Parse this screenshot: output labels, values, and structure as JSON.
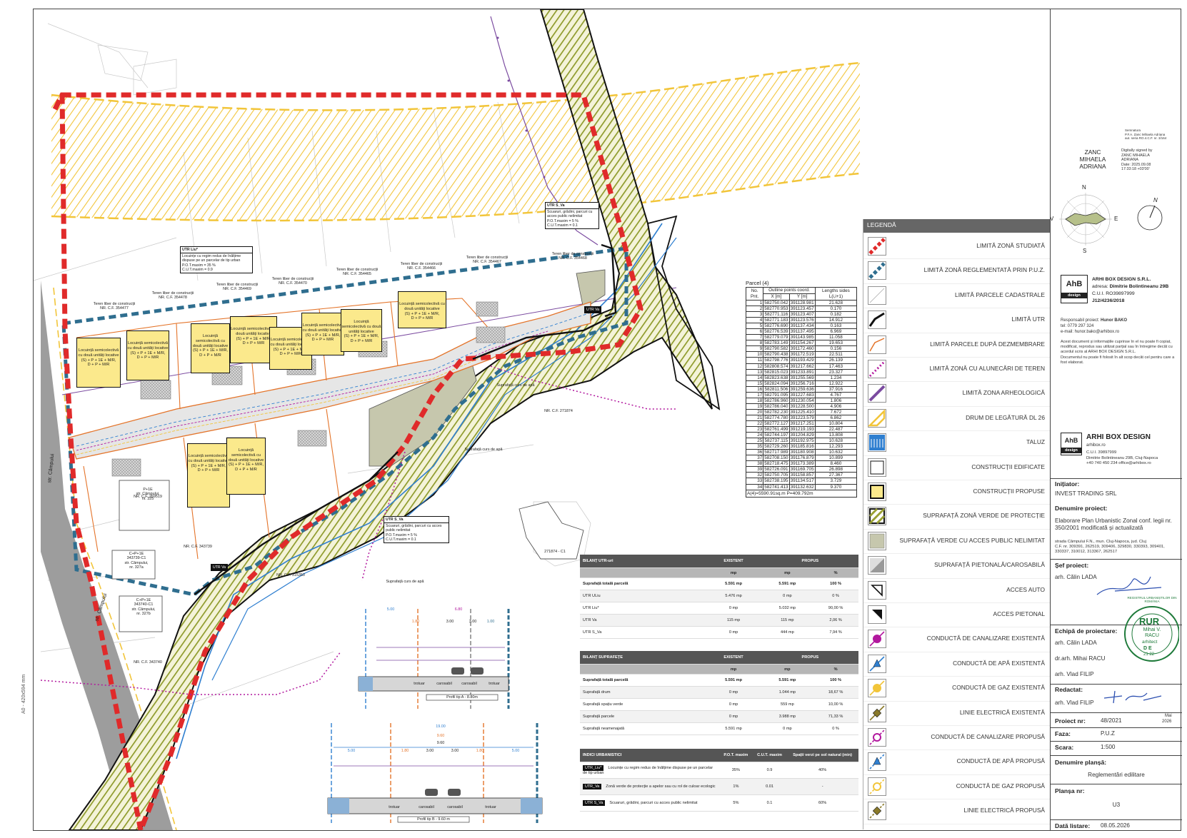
{
  "sideways_note": "A0 - 420x594 mm",
  "map": {
    "street_label_1": "str. Câmpului",
    "street_label_2": "str. Câmpului",
    "labels": [
      {
        "text": "Teren liber de construcții\nNR. C.F. 354477"
      },
      {
        "text": "Teren liber de construcții\nNR. C.F. 354478"
      },
      {
        "text": "Teren liber de construcții\nNR. C.F. 354469"
      },
      {
        "text": "Teren liber de construcții\nNR. C.F. 354470"
      },
      {
        "text": "Teren liber de construcții\nNR. C.F. 354465"
      },
      {
        "text": "Teren liber de construcții\nNR. C.F. 354466"
      },
      {
        "text": "Teren liber de construcții\nNR. C.F. 354467"
      },
      {
        "text": "Teren liber de construcții\nNR. C.F. 354468"
      },
      {
        "text": "NR. C.F. 271874"
      },
      {
        "text": "NR. C.F. 269519"
      },
      {
        "text": "NR. C.F. 343739"
      },
      {
        "text": "NR. C.F. 315350"
      },
      {
        "text": "NR. C.F. 343740"
      },
      {
        "text": "P+1E\nstr. Câmpului,\nnr. 325"
      },
      {
        "text": "C+P+1E\n343739-C1\nstr. Câmpului,\nnr. 327a"
      },
      {
        "text": "C+P+1E\n343740-C1\nstr. Câmpului,\nnr. 327b"
      },
      {
        "text": "271874 - C1"
      },
      {
        "text": "Suprafață curs de apă"
      },
      {
        "text": "Suprafață curs de apă"
      },
      {
        "text": "Suprafață curs de apă"
      }
    ],
    "buildings": [
      "Locuință semicolectivă cu două unități locative\n(S) + P + 1E + M/R,\nD + P + M/R",
      "Locuință semicolectivă cu două unități locative\n(S) + P + 1E + M/R,\nD + P + M/R",
      "Locuință semicolectivă cu două unități locative\n(S) + P + 1E + M/R,\nD + P + M/R",
      "Locuință semicolectivă cu două unități locative\n(S) + P + 1E + M/R,\nD + P + M/R",
      "Locuință semicolectivă cu două unități locative\n(S) + P + 1E + M/R,\nD + P + M/R",
      "Locuință semicolectivă cu două unități locative\n(S) + P + 1E + M/R,\nD + P + M/R",
      "Locuință semicolectivă cu două unități locative\n(S) + P + 1E + M/R,\nD + P + M/R",
      "Locuință semicolectivă cu două unități locative\n(S) + P + 1E + M/R,\nD + P + M/R",
      "Locuință semicolectivă cu două unități locative\n(S) + P + 1E + M/R,\nD + P + M/R",
      "Locuință semicolectivă cu două unități locative\n(S) + P + 1E + M/R,\nD + P + M/R"
    ],
    "utr_boxes": [
      {
        "title": "UTR Liu*",
        "text": "Locuințe cu regim redus de înălțime dispuse pe un parcelar de tip urban\nP.O.T.maxim = 35 %\nC.U.T.maxim = 0.9"
      },
      {
        "title": "UTR S_Va",
        "text": "Scuaruri, grădini, parcuri cu acces public nelimitat\nP.O.T.maxim = 5 %\nC.U.T.maxim = 0.1"
      },
      {
        "title": "UTR S_Va",
        "text": "Scuaruri, grădini, parcuri cu acces public nelimitat\nP.O.T.maxim = 5 %\nC.U.T.maxim = 0.1"
      }
    ],
    "profile_a": {
      "title": "Profil tip A - 8.80m",
      "dims": [
        "5.00",
        "6.80",
        "1.80",
        "3.00",
        "3.00",
        "1.00"
      ],
      "labels": [
        "trotuar",
        "carosabil",
        "carosabil",
        "trotuar"
      ]
    },
    "profile_b": {
      "title": "Profil tip B - 9.60 m",
      "dims": [
        "19.00",
        "9.60",
        "9.60",
        "5.00",
        "1.80",
        "3.00",
        "3.00",
        "1.80",
        "5.00"
      ],
      "labels": [
        "trotuar",
        "carosabil",
        "carosabil",
        "trotuar"
      ]
    },
    "utr_tags": [
      "UTR Va",
      "UTR Va"
    ]
  },
  "parcel": {
    "title": "Parcel (4)",
    "head_no": "No. Pnt.",
    "head_coord": "Outline points coord.",
    "head_x": "X [m]",
    "head_y": "Y [m]",
    "head_len": "Lengths sides L(i,i+1)",
    "rows": [
      [
        "1",
        "582750.042",
        "391128.981",
        "21.628"
      ],
      [
        "2",
        "582770.953",
        "391123.457",
        "0.170"
      ],
      [
        "3",
        "582771.116",
        "391123.407",
        "0.182"
      ],
      [
        "4",
        "582771.183",
        "391123.576",
        "14.912"
      ],
      [
        "5",
        "582776.690",
        "391137.434",
        "0.163"
      ],
      [
        "6",
        "582776.539",
        "391137.495",
        "6.969"
      ],
      [
        "7",
        "582779.079",
        "391143.985",
        "11.058"
      ],
      [
        "8",
        "582783.149",
        "391154.267",
        "19.653"
      ],
      [
        "9",
        "582790.582",
        "391172.460",
        "0.156"
      ],
      [
        "10",
        "582790.438",
        "391172.519",
        "22.511"
      ],
      [
        "11",
        "582798.776",
        "391193.429",
        "26.139"
      ],
      [
        "12",
        "582808.574",
        "391217.662",
        "17.463"
      ],
      [
        "13",
        "582815.023",
        "391233.891",
        "23.327"
      ],
      [
        "14",
        "582823.638",
        "391255.569",
        "1.234"
      ],
      [
        "15",
        "582824.094",
        "391256.716",
        "12.922"
      ],
      [
        "16",
        "582811.506",
        "391259.636",
        "37.916"
      ],
      [
        "17",
        "582791.095",
        "391227.683",
        "4.767"
      ],
      [
        "18",
        "582786.960",
        "391230.054",
        "1.806"
      ],
      [
        "19",
        "582786.040",
        "391228.500",
        "4.906"
      ],
      [
        "20",
        "582782.230",
        "391225.410",
        "7.672"
      ],
      [
        "21",
        "582774.780",
        "391223.579",
        "6.862"
      ],
      [
        "22",
        "582772.127",
        "391217.251",
        "10.804"
      ],
      [
        "23",
        "582761.499",
        "391219.193",
        "22.487"
      ],
      [
        "24",
        "582744.197",
        "391204.829",
        "13.808"
      ],
      [
        "25",
        "582737.115",
        "391192.975",
        "10.628"
      ],
      [
        "35",
        "582729.260",
        "391185.816",
        "12.293"
      ],
      [
        "36",
        "582717.989",
        "391180.908",
        "10.632"
      ],
      [
        "37",
        "582708.150",
        "391176.879",
        "10.899"
      ],
      [
        "38",
        "582718.475",
        "391173.389",
        "8.460"
      ],
      [
        "39",
        "582726.091",
        "391169.705",
        "26.898"
      ],
      [
        "32",
        "582750.705",
        "391158.857",
        "27.367"
      ],
      [
        "33",
        "582738.195",
        "391134.517",
        "3.729"
      ],
      [
        "34",
        "582741.413",
        "391132.632",
        "9.370"
      ]
    ],
    "footer": "A(4)=5590.91sq.m  P=409.792m"
  },
  "bilant_utr": {
    "title": "BILANȚ UTR-uri",
    "col_existent": "EXISTENT",
    "col_propus": "PROPUS",
    "u1": "mp",
    "u2": "mp",
    "u3": "%",
    "rows": [
      [
        "Suprafață totală parcelă",
        "5.591 mp",
        "5.591 mp",
        "100 %"
      ],
      [
        "UTR ULiu",
        "5.476 mp",
        "0 mp",
        "0 %"
      ],
      [
        "UTR Liu*",
        "0 mp",
        "5.032 mp",
        "90,00 %"
      ],
      [
        "UTR Va",
        "115 mp",
        "115 mp",
        "2,06 %"
      ],
      [
        "UTR S_Va",
        "0 mp",
        "444 mp",
        "7,94 %"
      ]
    ]
  },
  "bilant_supr": {
    "title": "BILANȚ SUPRAFEȚE",
    "col_existent": "EXISTENT",
    "col_propus": "PROPUS",
    "u1": "mp",
    "u2": "mp",
    "u3": "%",
    "rows": [
      [
        "Suprafață totală parcelă",
        "5.591 mp",
        "5.591 mp",
        "100 %"
      ],
      [
        "Suprafață drum",
        "0 mp",
        "1.044 mp",
        "18,67 %"
      ],
      [
        "Suprafață spațiu verde",
        "0 mp",
        "559 mp",
        "10,00 %"
      ],
      [
        "Suprafață parcele",
        "0 mp",
        "3.988 mp",
        "71,33 %"
      ],
      [
        "Suprafață neamenajată",
        "5.591 mp",
        "0 mp",
        "0 %"
      ]
    ]
  },
  "indici": {
    "title": "INDICI URBANISTICI",
    "col_pot": "P.O.T. maxim",
    "col_cut": "C.U.T. maxim",
    "col_verde": "Spații verzi pe sol natural (min)",
    "rows": [
      [
        "UTR_Liu*",
        "Locuințe cu regim redus de înălțime dispuse pe un parcelar de tip urban",
        "35%",
        "0.9",
        "40%"
      ],
      [
        "UTR_Va",
        "Zonă verde de protecție a apelor sau cu rol de culoar ecologic",
        "1%",
        "0.01",
        "-"
      ],
      [
        "UTR S_Va",
        "Scuaruri, grădini, parcuri cu acces public nelimitat",
        "5%",
        "0.1",
        "60%"
      ]
    ]
  },
  "legend": {
    "title": "LEGENDĂ",
    "items": [
      {
        "label": "LIMITĂ ZONĂ STUDIATĂ",
        "icon": "red-dash-line",
        "color": "#e02a2a"
      },
      {
        "label": "LIMITĂ ZONĂ REGLEMENTATĂ PRIN P.U.Z.",
        "icon": "blue-dash-line",
        "color": "#2f6e8f"
      },
      {
        "label": "LIMITĂ PARCELE CADASTRALE",
        "icon": "thin-line",
        "color": "#aaaaaa"
      },
      {
        "label": "LIMITĂ UTR",
        "icon": "black-line",
        "color": "#111111"
      },
      {
        "label": "LIMITĂ PARCELE DUPĂ DEZMEMBRARE",
        "icon": "orange-line",
        "color": "#e4742a"
      },
      {
        "label": "LIMITĂ ZONĂ CU ALUNECĂRI DE TEREN",
        "icon": "magenta-dot-line",
        "color": "#b2189e"
      },
      {
        "label": "LIMITĂ ZONA ARHEOLOGICĂ",
        "icon": "purple-line",
        "color": "#7b4ba0"
      },
      {
        "label": "DRUM DE LEGĂTURĂ DL 26",
        "icon": "yellow-hatch",
        "color": "#f2c53a"
      },
      {
        "label": "TALUZ",
        "icon": "blue-taluz",
        "color": "#2f7fd0"
      },
      {
        "label": "CONSTRUCȚII EDIFICATE",
        "icon": "white-box",
        "color": "#ffffff"
      },
      {
        "label": "CONSTRUCȚII PROPUSE",
        "icon": "yellow-box",
        "color": "#fbe98c"
      },
      {
        "label": "SUPRAFAȚĂ ZONĂ VERDE DE PROTECȚIE",
        "icon": "green-hatch",
        "color": "#9aa033"
      },
      {
        "label": "SUPRAFAȚĂ VERDE CU ACCES PUBLIC NELIMITAT",
        "icon": "grey-green-fill",
        "color": "#c6c7ad"
      },
      {
        "label": "SUPRAFAȚĂ PIETONALĂ/CAROSABILĂ",
        "icon": "grey-gradient",
        "color": "#999999"
      },
      {
        "label": "ACCES AUTO",
        "icon": "acces-auto",
        "color": "#111111"
      },
      {
        "label": "ACCES PIETONAL",
        "icon": "acces-pietonal",
        "color": "#111111"
      },
      {
        "label": "CONDUCTĂ DE CANALIZARE EXISTENTĂ",
        "icon": "canal-existent",
        "color": "#b2189e"
      },
      {
        "label": "CONDUCTĂ DE APĂ EXISTENTĂ",
        "icon": "apa-existent",
        "color": "#2f7fd0"
      },
      {
        "label": "CONDUCTĂ DE GAZ EXISTENTĂ",
        "icon": "gaz-existent",
        "color": "#f2c53a"
      },
      {
        "label": "LINIE ELECTRICĂ EXISTENTĂ",
        "icon": "electric-existent",
        "color": "#8a7a2a"
      },
      {
        "label": "CONDUCTĂ DE CANALIZARE PROPUSĂ",
        "icon": "canal-propus",
        "color": "#b2189e"
      },
      {
        "label": "CONDUCTĂ DE APĂ PROPUSĂ",
        "icon": "apa-propus",
        "color": "#2f7fd0"
      },
      {
        "label": "CONDUCTĂ DE GAZ PROPUSĂ",
        "icon": "gaz-propus",
        "color": "#f2c53a"
      },
      {
        "label": "LINIE ELECTRICĂ PROPUSĂ",
        "icon": "electric-propus",
        "color": "#8a7a2a"
      }
    ]
  },
  "signature": {
    "name": "ZANC\nMIHAELA\nADRIANA",
    "digital": "Digitally signed by\nZANC MIHAELA\nADRIANA\nDate: 2025.09.08\n17:33:18 +03'00'",
    "tiny": "Semnatura\nP.F.A. Zanc Mihaela Adriana\naut. seria RO.4.C.F. nr. 3/164"
  },
  "compass": {
    "n": "N",
    "s": "S",
    "e": "E",
    "v": "V",
    "north_arrow": "N"
  },
  "company": {
    "logo_letters": "AhB",
    "logo_sub": "design",
    "name": "ARHI BOX DESIGN S.R.L.",
    "address_label": "adresa:",
    "address": "Dimitrie Bolintineanu 29B",
    "cui": "C.U.I. RO39897999",
    "reg": "J12/4236/2018",
    "resp_label": "Responsabil proiect:",
    "resp": "Hunor BAKO",
    "tel": "tel: 0779 297 324",
    "email": "e-mail: hunor.bako@arhibox.ro",
    "notice": "Acest document și informațiile cuprinse în el nu poate fi copiat, modificat, reprodus sau utilizat parțial sau în întregime decât cu acordul scris al ARHI BOX DESIGN S.R.L.\nDocumentul nu poate fi folosit în alt scop decât cel pentru care a fost elaborat.",
    "stamp_name": "ARHI BOX DESIGN",
    "stamp_sub": "arhibox.ro",
    "stamp_lines": "C.U.I. 39897999\nDimitrie Bolintineanu 29B, Cluj-Napoca\n+40 740 450 234   office@arhibox.ro"
  },
  "title_block": {
    "initiator_label": "Inițiator:",
    "initiator": "INVEST TRADING SRL",
    "proj_name_label": "Denumire proiect:",
    "proj_name": "Elaborare Plan Urbanistic Zonal conf. legii nr. 350/2001 modificată și actualizată",
    "location": "strada Câmpului F.N., mun. Cluj-Napoca, jud. Cluj\nC.F. nr. 309391, 262519, 309406, 329830, 330393, 309401, 330337, 310012, 313367, 262517",
    "sef_label": "Șef proiect:",
    "sef": "arh. Călin LADA",
    "echipa_label": "Echipă de proiectare:",
    "echipa": [
      "arh. Călin LADA",
      "dr.arh. Mihai RACU",
      "arh. Vlad FILIP"
    ],
    "redactat_label": "Redactat:",
    "redactat": "arh. Vlad FILIP",
    "proiect_nr_label": "Proiect nr:",
    "proiect_nr": "48/2021",
    "date_month": "Mai",
    "date_year": "2026",
    "faza_label": "Faza:",
    "faza": "P.U.Z",
    "scara_label": "Scara:",
    "scara": "1:500",
    "plansa_name_label": "Denumire planșă:",
    "plansa_name": "Reglementări edilitare",
    "plansa_label": "Planșa nr:",
    "plansa": "U3",
    "data_label": "Dată listare:",
    "data": "08.05.2026",
    "rur_stamp": "RUR",
    "rur_ring": "REGISTRUL URBANIȘTILOR DIN ROMÂNIA",
    "rur_name": "Mihai V.\nRACU",
    "rur_title": "arhitect",
    "rur_grade": "D E",
    "rur_code": "21 22"
  },
  "colors": {
    "studied": "#e02a2a",
    "regulated": "#2f6e8f",
    "yellow_hatch": "#f2c53a",
    "green_hatch": "#9aa033",
    "building": "#fbe98c",
    "orange": "#e4742a",
    "magenta": "#b2189e",
    "purple": "#7b4ba0",
    "blue": "#2f7fd0"
  }
}
